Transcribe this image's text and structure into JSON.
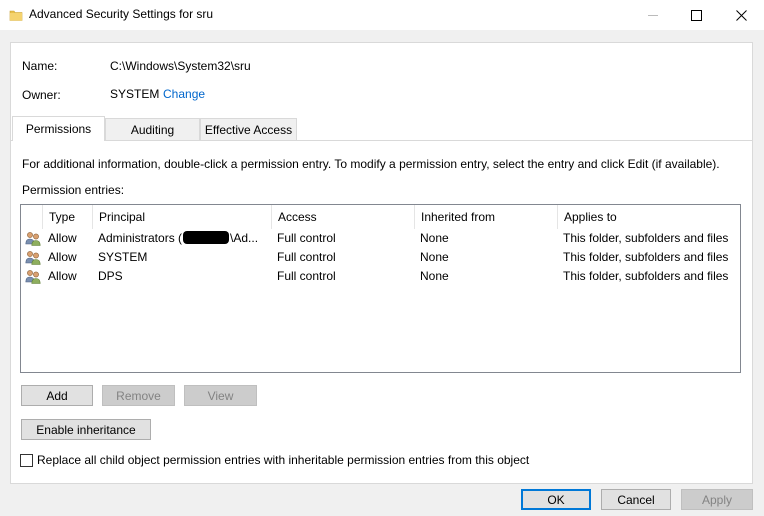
{
  "window": {
    "title": "Advanced Security Settings for sru",
    "minimize_glyph": "—",
    "maximize_glyph": "☐",
    "close_glyph": "✕"
  },
  "header": {
    "name_label": "Name:",
    "name_value": "C:\\Windows\\System32\\sru",
    "owner_label": "Owner:",
    "owner_value": "SYSTEM",
    "change_link": "Change"
  },
  "tabs": [
    {
      "label": "Permissions",
      "active": true
    },
    {
      "label": "Auditing",
      "active": false
    },
    {
      "label": "Effective Access",
      "active": false
    }
  ],
  "info_text": "For additional information, double-click a permission entry. To modify a permission entry, select the entry and click Edit (if available).",
  "entries_label": "Permission entries:",
  "columns": [
    "Type",
    "Principal",
    "Access",
    "Inherited from",
    "Applies to"
  ],
  "rows": [
    {
      "type": "Allow",
      "principal_pre": "Administrators (",
      "principal_post": "\\Ad...",
      "redacted": true,
      "access": "Full control",
      "inherited": "None",
      "applies": "This folder, subfolders and files"
    },
    {
      "type": "Allow",
      "principal_pre": "SYSTEM",
      "principal_post": "",
      "redacted": false,
      "access": "Full control",
      "inherited": "None",
      "applies": "This folder, subfolders and files"
    },
    {
      "type": "Allow",
      "principal_pre": "DPS",
      "principal_post": "",
      "redacted": false,
      "access": "Full control",
      "inherited": "None",
      "applies": "This folder, subfolders and files"
    }
  ],
  "buttons": {
    "add": "Add",
    "remove": "Remove",
    "view": "View",
    "enable_inheritance": "Enable inheritance",
    "ok": "OK",
    "cancel": "Cancel",
    "apply": "Apply"
  },
  "replace_checkbox": {
    "label": "Replace all child object permission entries with inheritable permission entries from this object",
    "checked": false
  },
  "icons": {
    "title": "folder-icon",
    "row": "user-group-icon"
  },
  "colors": {
    "link": "#0066cc",
    "folder": "#e8c04a",
    "default_button_border": "#0078d7"
  }
}
